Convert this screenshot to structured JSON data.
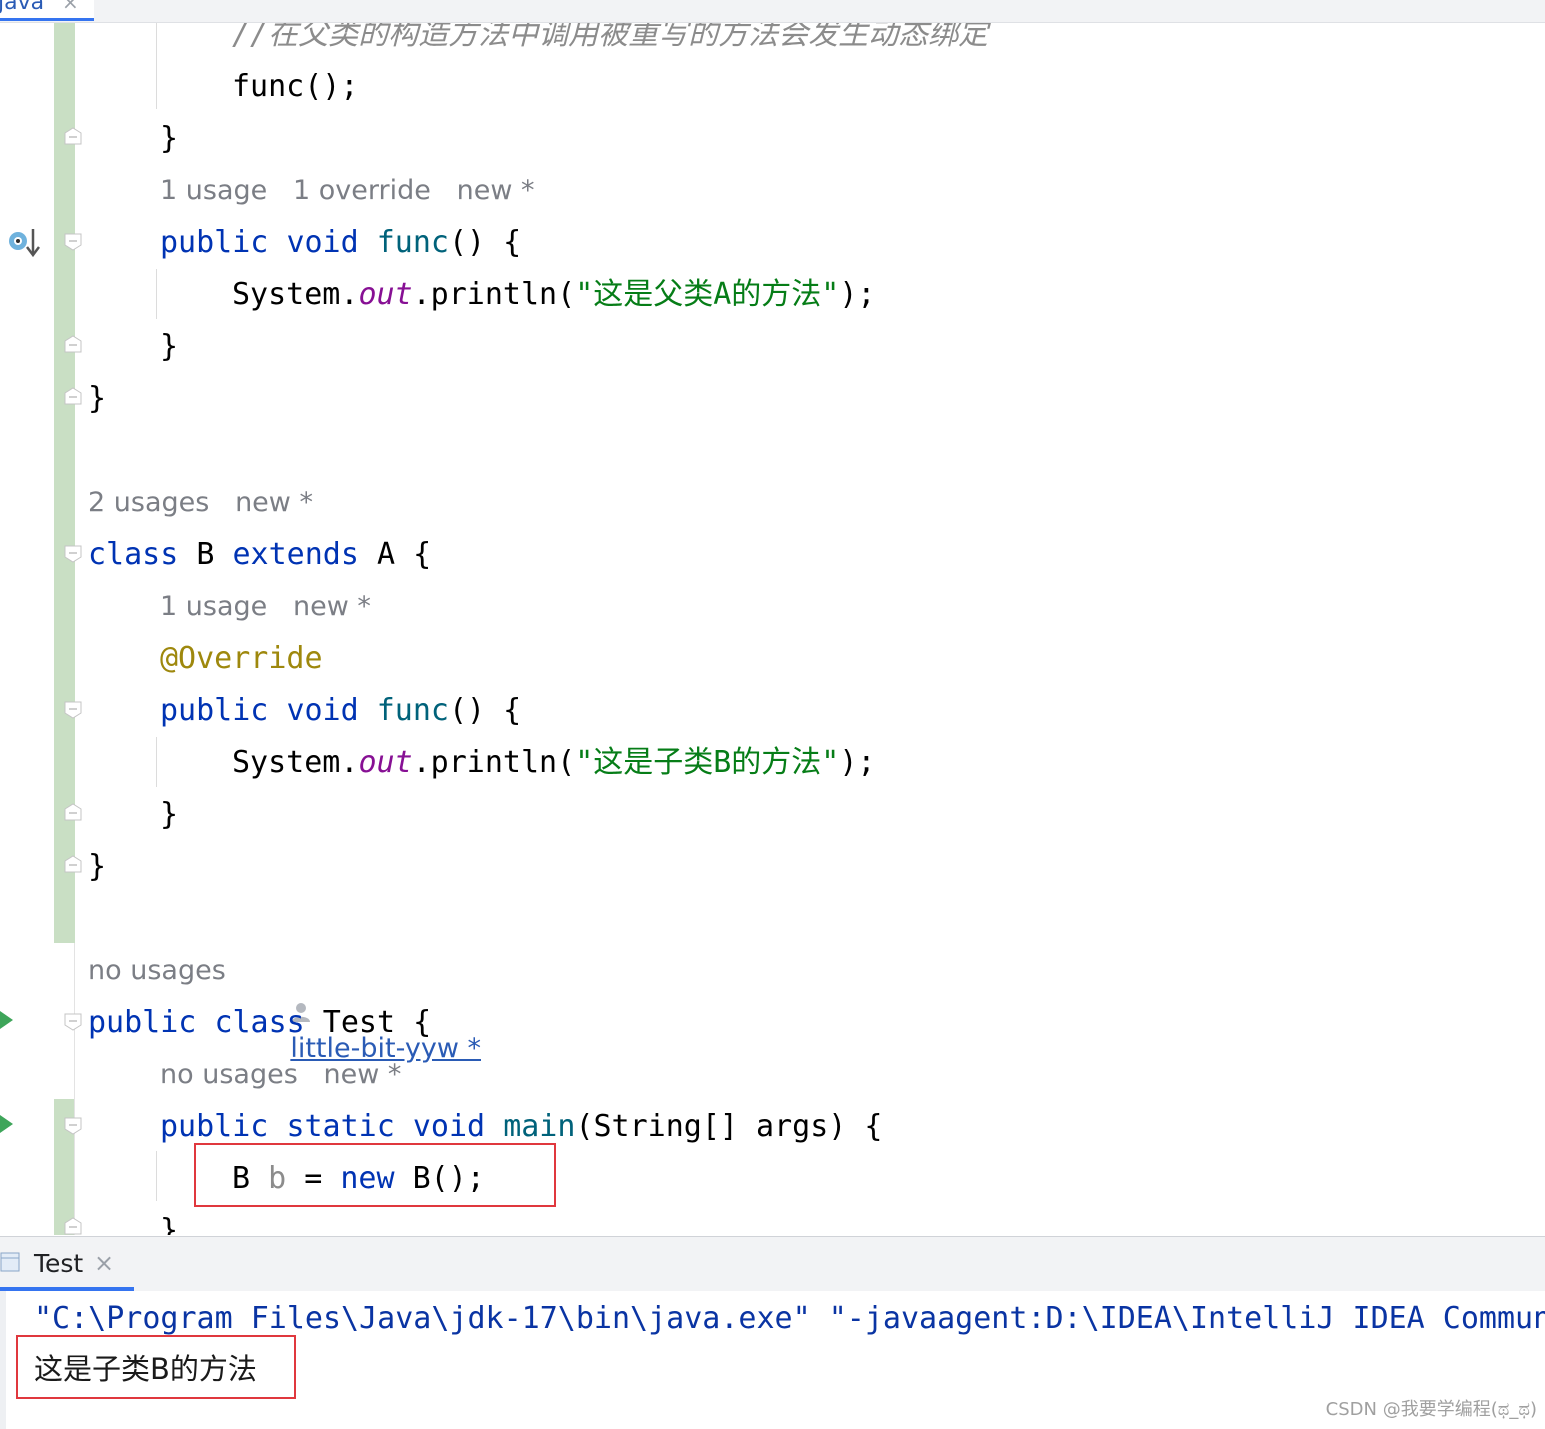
{
  "file_tab": {
    "name": "java",
    "close": "×"
  },
  "code": {
    "comment_line": "//在父类的构造方法中调用被重写的方法会发生动态绑定",
    "call_func": "func();",
    "brace_close": "}",
    "hint_a_func": {
      "usage": "1 usage",
      "override": "1 override",
      "new": "new *"
    },
    "kw_public": "public",
    "kw_void": "void",
    "fn_func": "func",
    "paren_open": "() {",
    "sys": "System.",
    "out": "out",
    "println": ".println(",
    "str_a": "\"这是父类A的方法\"",
    "str_b": "\"这是子类B的方法\"",
    "end_stmt": ");",
    "hint_b_class": {
      "usage": "2 usages",
      "new": "new *"
    },
    "kw_class": "class",
    "class_b_decl": " B ",
    "kw_extends": "extends",
    "class_b_rest": " A {",
    "hint_b_func": {
      "usage": "1 usage",
      "new": "new *"
    },
    "annotation": "@Override",
    "hint_test": {
      "usage": "no usages",
      "author": "little-bit-yyw *"
    },
    "class_test_rest": " Test {",
    "hint_main": {
      "usage": "no usages",
      "new": "new *"
    },
    "kw_static": "static",
    "fn_main": "main",
    "main_args": "(String[] args) {",
    "stmt_b_type": "B ",
    "stmt_b_var": "b",
    "stmt_eq": " = ",
    "kw_new": "new",
    "stmt_b_ctor": " B();"
  },
  "console": {
    "tab_label": "Test",
    "tab_close": "×",
    "command_part1": "\"C:\\Program Files\\Java\\jdk-17\\bin\\java.exe\"",
    "command_part2": " \"-javaagent:D:\\IDEA\\IntelliJ IDEA Commun",
    "output": "这是子类B的方法"
  },
  "watermark": "CSDN @我要学编程(ಥ_ಥ)",
  "colors": {
    "keyword": "#0033b3",
    "function": "#00627a",
    "string": "#067d17",
    "static_field": "#871094",
    "annotation": "#9e880d",
    "highlight_box": "#e0383e"
  }
}
